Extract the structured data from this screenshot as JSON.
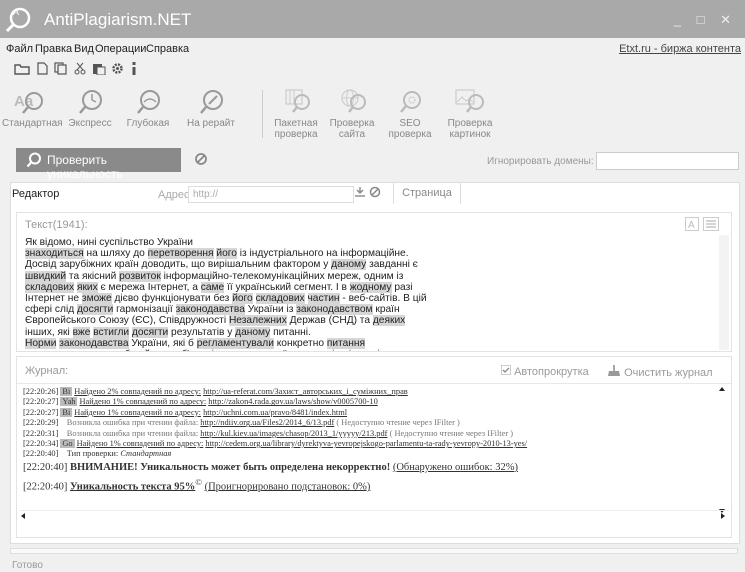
{
  "app": {
    "title": "AntiPlagiarism.NET",
    "window_controls": "_ □ ✕"
  },
  "menu": {
    "items": [
      "Файл",
      "Правка",
      "Вид",
      "Операции",
      "Справка"
    ],
    "etxt_link": "Etxt.ru - биржа контента"
  },
  "toolbar_icons": [
    "folder-open-icon",
    "new-file-icon",
    "copy-icon",
    "cut-icon",
    "paste-icon",
    "settings-icon",
    "info-icon"
  ],
  "check_types": [
    {
      "label": "Стандартная",
      "icon": "standard-check-icon"
    },
    {
      "label": "Экспресс",
      "icon": "express-check-icon"
    },
    {
      "label": "Глубокая",
      "icon": "deep-check-icon"
    },
    {
      "label": "На рерайт",
      "icon": "rewrite-check-icon"
    }
  ],
  "check_types_extra": [
    {
      "line1": "Пакетная",
      "line2": "проверка",
      "icon": "batch-check-icon"
    },
    {
      "line1": "Проверка",
      "line2": "сайта",
      "icon": "site-check-icon"
    },
    {
      "line1": "SEO",
      "line2": "проверка",
      "icon": "seo-check-icon"
    },
    {
      "line1": "Проверка",
      "line2": "картинок",
      "icon": "image-check-icon"
    }
  ],
  "actions": {
    "check_button": "Проверить уникальность",
    "ignore_domains_label": "Игнорировать домены:",
    "ignore_domains_value": ""
  },
  "editor": {
    "tab_editor": "Редактор",
    "address_label": "Адрес:",
    "address_placeholder": "http://",
    "tab_page": "Страница",
    "text_header": "Текст(1941):"
  },
  "text_lines": [
    [
      {
        "t": "Як відомо, нині суспільство України",
        "h": false
      }
    ],
    [
      {
        "t": "знаходиться",
        "h": true
      },
      {
        "t": " на шляху до ",
        "h": false
      },
      {
        "t": "перетворення",
        "h": true
      },
      {
        "t": " ",
        "h": false
      },
      {
        "t": "його",
        "h": true
      },
      {
        "t": " із індустріального на інформаційне.",
        "h": false
      }
    ],
    [
      {
        "t": "Досвід зарубіжних країн доводить, що вирішальним фактором у ",
        "h": false
      },
      {
        "t": "даному",
        "h": true
      },
      {
        "t": " завданні є",
        "h": false
      }
    ],
    [
      {
        "t": "швидкий",
        "h": true
      },
      {
        "t": " та якісний ",
        "h": false
      },
      {
        "t": "розвиток",
        "h": true
      },
      {
        "t": " інформаційно-телекомунікаційних мереж, одним із",
        "h": false
      }
    ],
    [
      {
        "t": "складових",
        "h": true
      },
      {
        "t": " ",
        "h": false
      },
      {
        "t": "яких",
        "h": true
      },
      {
        "t": " є мережа Інтернет, а ",
        "h": false
      },
      {
        "t": "саме",
        "h": true
      },
      {
        "t": " її український сегмент. І в ",
        "h": false
      },
      {
        "t": "жодному",
        "h": true
      },
      {
        "t": " разі",
        "h": false
      }
    ],
    [
      {
        "t": "Інтернет не ",
        "h": false
      },
      {
        "t": "зможе",
        "h": true
      },
      {
        "t": " дієво функціонувати без ",
        "h": false
      },
      {
        "t": "його",
        "h": true
      },
      {
        "t": " ",
        "h": false
      },
      {
        "t": "складових",
        "h": true
      },
      {
        "t": " ",
        "h": false
      },
      {
        "t": "частин",
        "h": true
      },
      {
        "t": " - веб-сайтів. В цій",
        "h": false
      }
    ],
    [
      {
        "t": "сфері слід ",
        "h": false
      },
      {
        "t": "досягти",
        "h": true
      },
      {
        "t": " гармонізації ",
        "h": false
      },
      {
        "t": "законодавства",
        "h": true
      },
      {
        "t": " України із ",
        "h": false
      },
      {
        "t": "законодавством",
        "h": true
      },
      {
        "t": " країн",
        "h": false
      }
    ],
    [
      {
        "t": "Європейського Союзу (ЄС), Співдружності ",
        "h": false
      },
      {
        "t": "Незалежних",
        "h": true
      },
      {
        "t": " Держав (СНД) та ",
        "h": false
      },
      {
        "t": "деяких",
        "h": true
      }
    ],
    [
      {
        "t": "інших, які ",
        "h": false
      },
      {
        "t": "вже",
        "h": true
      },
      {
        "t": " ",
        "h": false
      },
      {
        "t": "встигли",
        "h": true
      },
      {
        "t": " ",
        "h": false
      },
      {
        "t": "досягти",
        "h": true
      },
      {
        "t": " результатів у ",
        "h": false
      },
      {
        "t": "даному",
        "h": true
      },
      {
        "t": " питанні.",
        "h": false
      }
    ],
    [
      {
        "t": "Норми",
        "h": true
      },
      {
        "t": " ",
        "h": false
      },
      {
        "t": "законодавства",
        "h": true
      },
      {
        "t": " України, які б ",
        "h": false
      },
      {
        "t": "регламентували",
        "h": true
      },
      {
        "t": " конкретно ",
        "h": false
      },
      {
        "t": "питання",
        "h": true
      }
    ],
    [
      {
        "t": "правового статусу веб-сайту як об'єкту інтелектуальної власності - відсутні порядок",
        "h": false
      }
    ]
  ],
  "journal": {
    "header": "Журнал:",
    "autoscroll": "Автопрокрутка",
    "clear": "Очистить журнал",
    "lines": [
      {
        "ts": "[22:20:26]",
        "tag": "Bi",
        "text": "Найдено 2% совпадений по адресу:",
        "url": "http://ua-referat.com/Захист_авторських_і_суміжних_прав",
        "gray": false
      },
      {
        "ts": "[22:20:27]",
        "tag": "Yah",
        "text": "Найдено 1% совпадений по адресу:",
        "url": "http://zakon4.rada.gov.ua/laws/show/v0005700-10",
        "gray": false
      },
      {
        "ts": "[22:20:27]",
        "tag": "Bi",
        "text": "Найдено 1% совпадений по адресу:",
        "url": "http://uchni.com.ua/pravo/8481/index.html",
        "gray": false
      },
      {
        "ts": "[22:20:29]",
        "tag": "",
        "text": "Возникла ошибка при чтении файла:",
        "url": "http://ndiiv.org.ua/Files2/2014_6/13.pdf",
        "suffix": "( Недоступно чтение через IFilter )",
        "gray": true
      },
      {
        "ts": "[22:20:31]",
        "tag": "",
        "text": "Возникла ошибка при чтении файла:",
        "url": "http://kul.kiev.ua/images/chasop/2013_1/yyyyy/213.pdf",
        "suffix": "( Недоступно чтение через IFilter )",
        "gray": true
      },
      {
        "ts": "[22:20:34]",
        "tag": "Go",
        "text": "Найдено 1% совпадений по адресу:",
        "url": "http://cedem.org.ua/library/dyrektyva-yevropejskogo-parlamentu-ta-rady-yevropy-2010-13-yes/",
        "gray": false
      },
      {
        "ts": "[22:20:40]",
        "tag": "",
        "text": "Тип проверки:",
        "italic": "Стандартная",
        "gray": false
      }
    ],
    "warning_ts": "[22:20:40]",
    "warning_bold": "ВНИМАНИЕ! Уникальность может быть определена некорректно!",
    "warning_link": "(Обнаружено ошибок: 32%)",
    "result_ts": "[22:20:40]",
    "result_bold": "Уникальность текста 95%",
    "result_sup": "©",
    "result_link": "(Проигнорировано подстановок: 0%)"
  },
  "status": "Готово"
}
